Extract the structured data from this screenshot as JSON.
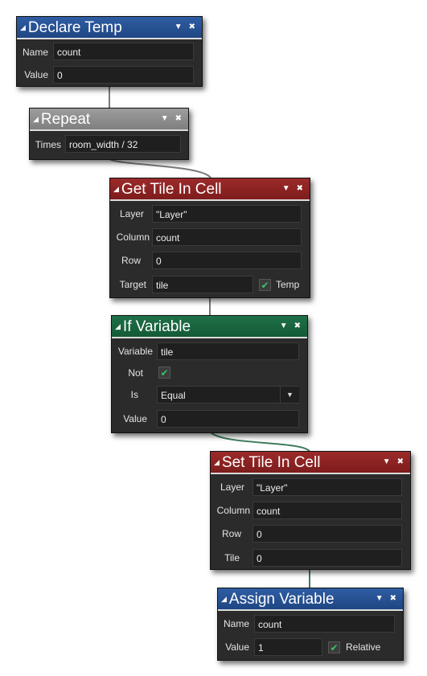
{
  "blocks": {
    "declare_temp": {
      "title": "Declare Temp",
      "name_label": "Name",
      "name_value": "count",
      "value_label": "Value",
      "value_value": "0"
    },
    "repeat": {
      "title": "Repeat",
      "times_label": "Times",
      "times_value": "room_width / 32"
    },
    "get_tile": {
      "title": "Get Tile In Cell",
      "layer_label": "Layer",
      "layer_value": "\"Layer\"",
      "column_label": "Column",
      "column_value": "count",
      "row_label": "Row",
      "row_value": "0",
      "target_label": "Target",
      "target_value": "tile",
      "temp_label": "Temp",
      "temp_checked": true
    },
    "if_variable": {
      "title": "If Variable",
      "variable_label": "Variable",
      "variable_value": "tile",
      "not_label": "Not",
      "not_checked": true,
      "is_label": "Is",
      "is_value": "Equal",
      "value_label": "Value",
      "value_value": "0"
    },
    "set_tile": {
      "title": "Set Tile In Cell",
      "layer_label": "Layer",
      "layer_value": "\"Layer\"",
      "column_label": "Column",
      "column_value": "count",
      "row_label": "Row",
      "row_value": "0",
      "tile_label": "Tile",
      "tile_value": "0"
    },
    "assign_variable": {
      "title": "Assign Variable",
      "name_label": "Name",
      "name_value": "count",
      "value_label": "Value",
      "value_value": "1",
      "relative_label": "Relative",
      "relative_checked": true
    }
  },
  "colors": {
    "header_blue": "#2f5da3",
    "header_grey": "#9d9d9d",
    "header_red": "#9c2a2a",
    "header_green": "#1f7048",
    "panel": "#2b2b2b",
    "check": "#3fbf6c"
  },
  "icons": {
    "collapse": "collapse-triangle-icon",
    "menu": "dropdown-arrow-icon",
    "close": "close-icon",
    "check": "checkmark-icon"
  }
}
